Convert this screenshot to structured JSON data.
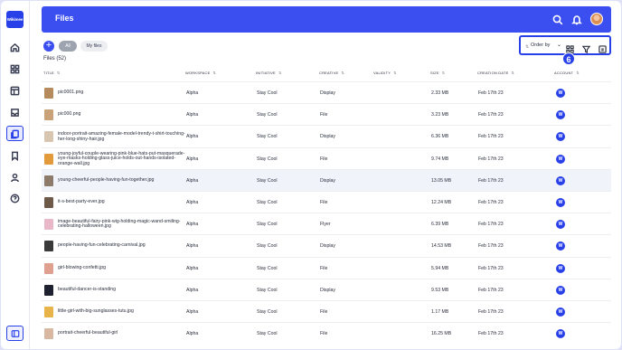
{
  "app": {
    "logo_text": "Wikimee",
    "page_title": "Files"
  },
  "rail": {
    "items": [
      {
        "icon": "home-icon"
      },
      {
        "icon": "grid-icon"
      },
      {
        "icon": "layout-icon"
      },
      {
        "icon": "inbox-icon"
      },
      {
        "icon": "files-icon"
      },
      {
        "icon": "bookmark-icon"
      },
      {
        "icon": "user-icon"
      },
      {
        "icon": "help-icon"
      }
    ],
    "active": "files-icon",
    "bottom_icon": "panel-toggle-icon"
  },
  "header": {
    "search_icon": "search-icon",
    "bell_icon": "bell-icon",
    "avatar": "avatar"
  },
  "filters": {
    "add_label": "+",
    "all_label": "All",
    "my_files_label": "My files"
  },
  "files_count": "Files  (52)",
  "toolbar": {
    "order_label": "Order by",
    "step_badge": "6",
    "accent": "#2840e8"
  },
  "columns": [
    "TITLE",
    "WORKSPACE",
    "INITIATIVE",
    "CREATIVE",
    "VALIDITY",
    "SIZE",
    "CREATION DATE",
    "ACCOUNT"
  ],
  "rows": [
    {
      "title": "pic0001.png",
      "workspace": "Alpha",
      "initiative": "Stay Cool",
      "creative": "Display",
      "validity": "",
      "size": "2.33 MB",
      "date": "Feb 17th 23",
      "account": "W",
      "thumb": "#b58a5c"
    },
    {
      "title": "pic000.png",
      "workspace": "Alpha",
      "initiative": "Stay Cool",
      "creative": "File",
      "validity": "",
      "size": "3.23 MB",
      "date": "Feb 17th 23",
      "account": "W",
      "thumb": "#c9a27a"
    },
    {
      "title": "indoor-portrait-amazing-female-model-trendy-t-shirt-touching-her-long-shiny-hair.jpg",
      "workspace": "Alpha",
      "initiative": "Stay Cool",
      "creative": "Display",
      "validity": "",
      "size": "6.36 MB",
      "date": "Feb 17th 23",
      "account": "W",
      "thumb": "#d9c6b0"
    },
    {
      "title": "young-joyful-couple-wearing-pink-blue-hats-put-masquerade-eye-masks-holding-glass-juice-holds-out-hands-isolated-orange-wall.jpg",
      "workspace": "Alpha",
      "initiative": "Stay Cool",
      "creative": "File",
      "validity": "",
      "size": "9.74 MB",
      "date": "Feb 17th 23",
      "account": "W",
      "thumb": "#e39a3b"
    },
    {
      "title": "young-cheerful-people-having-fun-together.jpg",
      "workspace": "Alpha",
      "initiative": "Stay Cool",
      "creative": "Display",
      "validity": "",
      "size": "13.05 MB",
      "date": "Feb 17th 23",
      "account": "W",
      "thumb": "#8c7a6a"
    },
    {
      "title": "it-s-best-party-ever.jpg",
      "workspace": "Alpha",
      "initiative": "Stay Cool",
      "creative": "File",
      "validity": "",
      "size": "12.24 MB",
      "date": "Feb 17th 23",
      "account": "W",
      "thumb": "#6e5a48"
    },
    {
      "title": "image-beautiful-fairy-pink-wig-holding-magic-wand-smiling-celebrating-halloween.jpg",
      "workspace": "Alpha",
      "initiative": "Stay Cool",
      "creative": "Flyer",
      "validity": "",
      "size": "6.39 MB",
      "date": "Feb 17th 23",
      "account": "W",
      "thumb": "#e8b7c8"
    },
    {
      "title": "people-having-fun-celebrating-carnival.jpg",
      "workspace": "Alpha",
      "initiative": "Stay Cool",
      "creative": "Display",
      "validity": "",
      "size": "14.53 MB",
      "date": "Feb 17th 23",
      "account": "W",
      "thumb": "#3a3a3a"
    },
    {
      "title": "girl-blowing-confetti.jpg",
      "workspace": "Alpha",
      "initiative": "Stay Cool",
      "creative": "File",
      "validity": "",
      "size": "5.94 MB",
      "date": "Feb 17th 23",
      "account": "W",
      "thumb": "#e0a090"
    },
    {
      "title": "beautiful-dancer-is-standing",
      "workspace": "Alpha",
      "initiative": "Stay Cool",
      "creative": "Display",
      "validity": "",
      "size": "9.53 MB",
      "date": "Feb 17th 23",
      "account": "W",
      "thumb": "#1e2230"
    },
    {
      "title": "little-girl-with-big-sunglasses-tutu.jpg",
      "workspace": "Alpha",
      "initiative": "Stay Cool",
      "creative": "File",
      "validity": "",
      "size": "1.17 MB",
      "date": "Feb 17th 23",
      "account": "W",
      "thumb": "#e8b44a"
    },
    {
      "title": "portrait-cheerful-beautiful-girl",
      "workspace": "Alpha",
      "initiative": "Stay Cool",
      "creative": "File",
      "validity": "",
      "size": "16.25 MB",
      "date": "Feb 17th 23",
      "account": "W",
      "thumb": "#d8b8a0"
    }
  ],
  "highlighted_row": 4
}
